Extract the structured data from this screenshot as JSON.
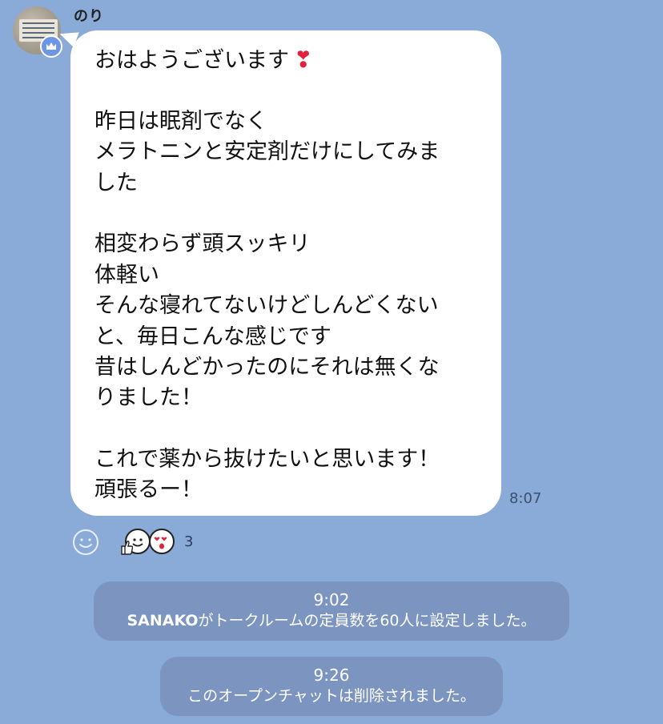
{
  "chat": {
    "sender_name": "のり",
    "avatar_text": "Solaris BioHealer for Asia",
    "message": {
      "lines": [
        "おはようございます",
        "",
        "昨日は眠剤でなく",
        "メラトニンと安定剤だけにしてみま",
        "した",
        "",
        "相変わらず頭スッキリ",
        "体軽い",
        "そんな寝れてないけどしんどくない",
        "と、毎日こんな感じです",
        "昔はしんどかったのにそれは無くな",
        "りました！",
        "",
        "これで薬から抜けたいと思います！",
        "頑張るー！"
      ],
      "emoji": "❣",
      "time": "8:07"
    },
    "reactions": {
      "count": "3",
      "icons": [
        "thumbs-up-smile-face-icon",
        "heart-eyes-face-icon"
      ],
      "colors": {
        "heart": "#e0223b"
      }
    },
    "system_messages": [
      {
        "time": "9:02",
        "actor": "SANAKO",
        "text": "がトークルームの定員数を60人に設定しました。"
      },
      {
        "time": "9:26",
        "text": "このオープンチャットは削除されました。"
      }
    ]
  },
  "colors": {
    "background": "#8aaad8",
    "bubble": "#ffffff",
    "system_pill": "#7b95c0",
    "badge": "#6e95e6"
  }
}
